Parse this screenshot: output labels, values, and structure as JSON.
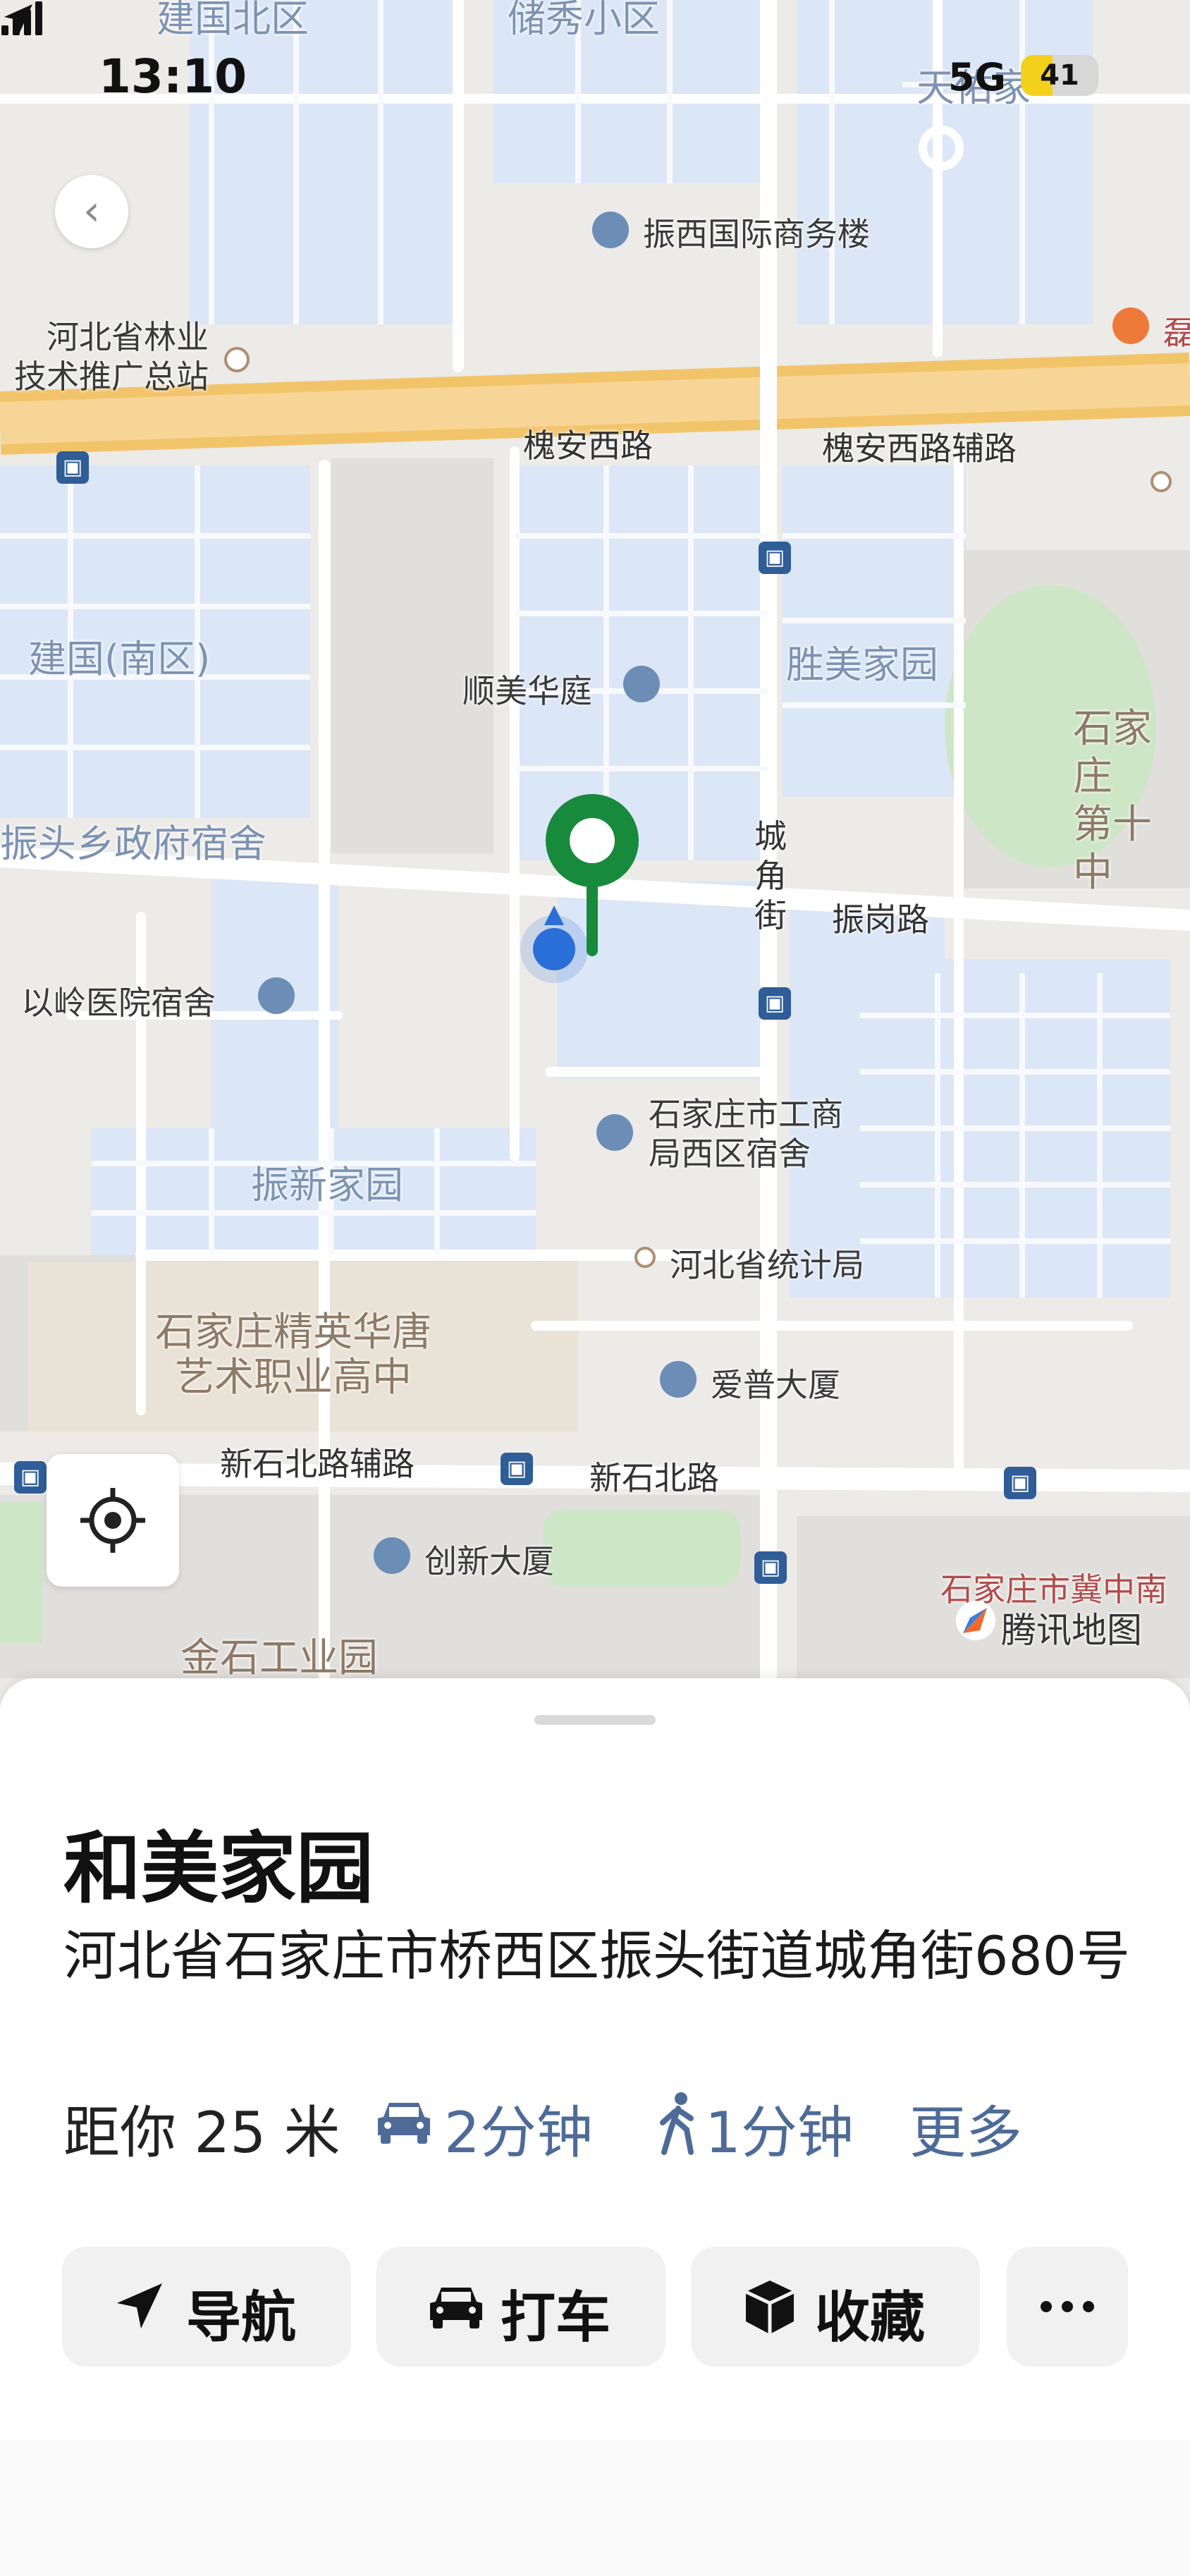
{
  "status_bar": {
    "time": "13:10",
    "network": "5G",
    "battery": "41",
    "battery_level": 0.41
  },
  "map": {
    "roads": {
      "huaian_west": "槐安西路",
      "huaian_west_aux": "槐安西路辅路",
      "zhengang": "振岗路",
      "chengjiao_street": "城\n角\n街",
      "xinshi_north": "新石北路",
      "xinshi_north_aux": "新石北路辅路"
    },
    "areas": {
      "jianguo_north": "建国北区",
      "chuxiu": "储秀小区",
      "jianguo_south": "建国(南区)",
      "shengmei": "胜美家园",
      "zhentou_dorm": "振头乡政府宿舍",
      "zhenxin": "振新家园",
      "shijiazhuang_school": "石家庄精英华唐\n艺术职业高中",
      "sjz_10th": "石家庄\n第十中",
      "jinshi": "金石工业园",
      "jizhong_south": "石家庄市冀中南"
    },
    "pois": {
      "zhenxi_business": "振西国际商务楼",
      "forestry": "河北省林业\n技术推广总站",
      "shunmei": "顺美华庭",
      "yiling_dorm": "以岭医院宿舍",
      "sjz_commerce": "石家庄市工商\n局西区宿舍",
      "stats_bureau": "河北省统计局",
      "aipu": "爱普大厦",
      "chuangxin": "创新大厦",
      "leng": "磊",
      "tianfu": "天佑家"
    },
    "attribution": "腾讯地图",
    "colors": {
      "pin": "#178a3c",
      "user_dot": "#2a6ed8",
      "road_main": "#f5c263",
      "block": "#dae6f7"
    }
  },
  "place": {
    "title": "和美家园",
    "address": "河北省石家庄市桥西区振头街道城角街680号",
    "distance": "距你 25 米",
    "drive_time": "2分钟",
    "walk_time": "1分钟",
    "more": "更多"
  },
  "actions": {
    "navigate": "导航",
    "taxi": "打车",
    "favorite": "收藏"
  }
}
